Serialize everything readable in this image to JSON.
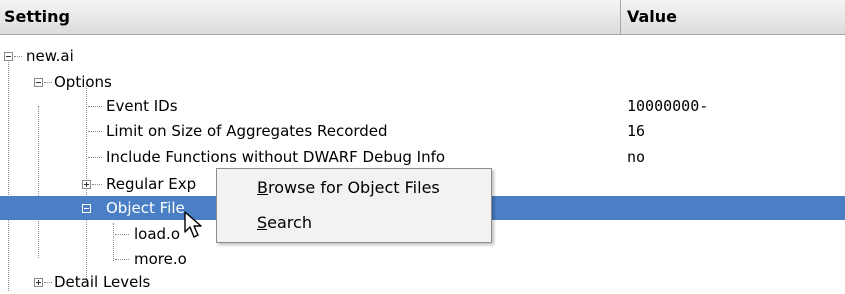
{
  "header": {
    "setting": "Setting",
    "value": "Value"
  },
  "tree": {
    "root": "new.ai",
    "options": "Options",
    "event_ids": {
      "label": "Event IDs",
      "value": "10000000-"
    },
    "limit_size": {
      "label": "Limit on Size of Aggregates Recorded",
      "value": "16"
    },
    "include_functions": {
      "label": "Include Functions without DWARF Debug Info",
      "value": "no"
    },
    "regular_exp": "Regular Exp",
    "object_files": "Object File",
    "load": "load.o",
    "more": "more.o",
    "detail_levels": "Detail Levels"
  },
  "context_menu": {
    "browse": {
      "mnemonic": "B",
      "rest": "rowse for Object Files"
    },
    "search": {
      "mnemonic": "S",
      "rest": "earch"
    }
  },
  "colors": {
    "selection": "#4a7fc6",
    "menu_bg": "#f2f2f2"
  }
}
